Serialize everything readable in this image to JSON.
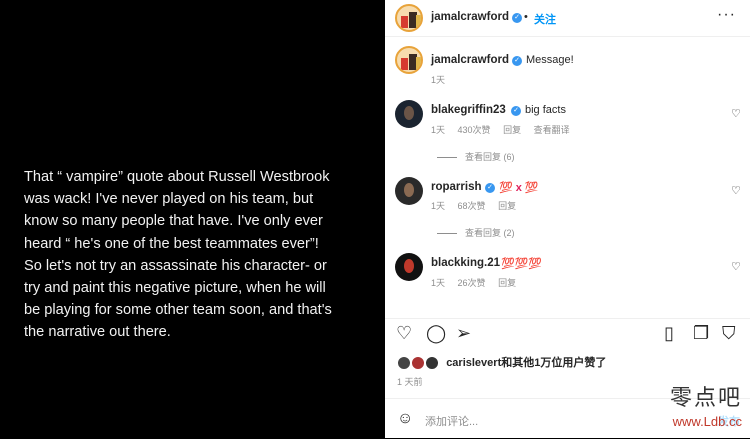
{
  "post": {
    "text": "That “ vampire” quote about Russell Westbrook\nwas wack! I've never played on his team, but\nknow so many people that have. I've only ever\nheard “ he's one of the best teammates ever”!\nSo let's not try an assassinate his character- or\ntry and paint this negative picture, when he will\nbe playing for some other team soon, and that's\nthe narrative out there."
  },
  "header": {
    "username": "jamalcrawford",
    "follow_label": "关注",
    "separator": "•",
    "more_icon": "more-horizontal-icon"
  },
  "caption": {
    "username": "jamalcrawford",
    "text": "Message!",
    "time": "1天"
  },
  "comments": [
    {
      "username": "blakegriffin23",
      "text": "big facts",
      "time": "1天",
      "likes": "430次赞",
      "reply": "回复",
      "translate": "查看翻译",
      "view_replies": "查看回复 (6)"
    },
    {
      "username": "roparrish",
      "text": "💯 x 💯",
      "time": "1天",
      "likes": "68次赞",
      "reply": "回复",
      "view_replies": "查看回复 (2)"
    },
    {
      "username": "blackking.21",
      "text": "💯💯💯",
      "time": "1天",
      "likes": "26次赞",
      "reply": "回复"
    }
  ],
  "likes_line": "carislevert和其他1万位用户赞了",
  "post_time": "1 天前",
  "comment_box": {
    "placeholder": "添加评论...",
    "post_label": "发布"
  },
  "watermark": {
    "cn": "零点吧",
    "url": "www.Ldb.cc"
  },
  "colors": {
    "accent": "#0095f6",
    "verified": "#3897f0"
  }
}
